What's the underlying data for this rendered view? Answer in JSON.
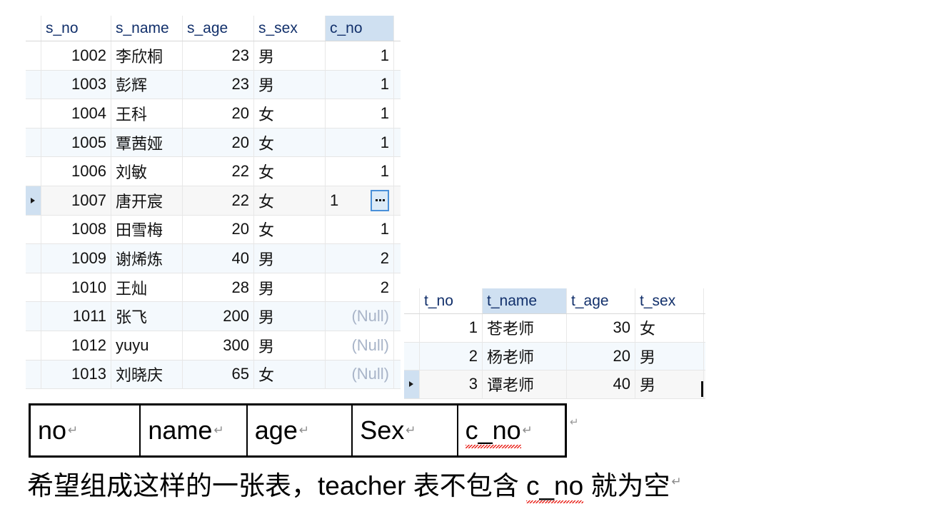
{
  "student_grid": {
    "name": "student-result-grid",
    "columns": [
      {
        "key": "s_no",
        "label": "s_no",
        "align": "num"
      },
      {
        "key": "s_name",
        "label": "s_name",
        "align": "txt"
      },
      {
        "key": "s_age",
        "label": "s_age",
        "align": "num"
      },
      {
        "key": "s_sex",
        "label": "s_sex",
        "align": "txt"
      },
      {
        "key": "c_no",
        "label": "c_no",
        "align": "num",
        "selected": true
      }
    ],
    "selected_column": "c_no",
    "selected_row_index": 5,
    "active_cell": {
      "row": 5,
      "column": "c_no",
      "value": "1",
      "editor_button": "..."
    },
    "null_text": "(Null)",
    "rows": [
      {
        "s_no": "1002",
        "s_name": "李欣桐",
        "s_age": "23",
        "s_sex": "男",
        "c_no": "1"
      },
      {
        "s_no": "1003",
        "s_name": "彭辉",
        "s_age": "23",
        "s_sex": "男",
        "c_no": "1"
      },
      {
        "s_no": "1004",
        "s_name": "王科",
        "s_age": "20",
        "s_sex": "女",
        "c_no": "1"
      },
      {
        "s_no": "1005",
        "s_name": "覃茜娅",
        "s_age": "20",
        "s_sex": "女",
        "c_no": "1"
      },
      {
        "s_no": "1006",
        "s_name": "刘敏",
        "s_age": "22",
        "s_sex": "女",
        "c_no": "1"
      },
      {
        "s_no": "1007",
        "s_name": "唐开宸",
        "s_age": "22",
        "s_sex": "女",
        "c_no": "1"
      },
      {
        "s_no": "1008",
        "s_name": "田雪梅",
        "s_age": "20",
        "s_sex": "女",
        "c_no": "1"
      },
      {
        "s_no": "1009",
        "s_name": "谢烯炼",
        "s_age": "40",
        "s_sex": "男",
        "c_no": "2"
      },
      {
        "s_no": "1010",
        "s_name": "王灿",
        "s_age": "28",
        "s_sex": "男",
        "c_no": "2"
      },
      {
        "s_no": "1011",
        "s_name": "张飞",
        "s_age": "200",
        "s_sex": "男",
        "c_no": "(Null)"
      },
      {
        "s_no": "1012",
        "s_name": "yuyu",
        "s_age": "300",
        "s_sex": "男",
        "c_no": "(Null)"
      },
      {
        "s_no": "1013",
        "s_name": "刘晓庆",
        "s_age": "65",
        "s_sex": "女",
        "c_no": "(Null)"
      }
    ]
  },
  "teacher_grid": {
    "name": "teacher-result-grid",
    "columns": [
      {
        "key": "t_no",
        "label": "t_no",
        "align": "num"
      },
      {
        "key": "t_name",
        "label": "t_name",
        "align": "txt",
        "selected": true
      },
      {
        "key": "t_age",
        "label": "t_age",
        "align": "num"
      },
      {
        "key": "t_sex",
        "label": "t_sex",
        "align": "txt"
      }
    ],
    "selected_column": "t_name",
    "selected_row_index": 2,
    "rows": [
      {
        "t_no": "1",
        "t_name": "苍老师",
        "t_age": "30",
        "t_sex": "女"
      },
      {
        "t_no": "2",
        "t_name": "杨老师",
        "t_age": "20",
        "t_sex": "男"
      },
      {
        "t_no": "3",
        "t_name": "谭老师",
        "t_age": "40",
        "t_sex": "男"
      }
    ]
  },
  "word_table": {
    "name": "desired-schema-table",
    "cells": [
      {
        "label": "no",
        "pilcrow": "↵",
        "spellcheck_error": false
      },
      {
        "label": "name",
        "pilcrow": "↵",
        "spellcheck_error": false
      },
      {
        "label": "age",
        "pilcrow": "↵",
        "spellcheck_error": false
      },
      {
        "label": "Sex",
        "pilcrow": "↵",
        "spellcheck_error": false
      },
      {
        "label": "c_no",
        "pilcrow": "↵",
        "spellcheck_error": true
      }
    ]
  },
  "caption": {
    "name": "caption-sentence",
    "part1": "希望组成这样的一张表，",
    "part2": "teacher",
    "part3": " 表不包含 ",
    "part4": "c_no",
    "part5": " 就为空",
    "pilcrow": "↵",
    "full_text": "希望组成这样的一张表，teacher 表不包含 c_no 就为空"
  },
  "colors": {
    "header_text": "#12306b",
    "selected_column_bg": "#cfe0f1",
    "alt_row_bg": "#f4f9fd",
    "null_text": "#a8b4c8",
    "editor_border": "#4a90d9",
    "editor_bg": "#dcebf8",
    "spellcheck_underline": "#e8140c",
    "pilcrow": "#8c8c8c"
  }
}
